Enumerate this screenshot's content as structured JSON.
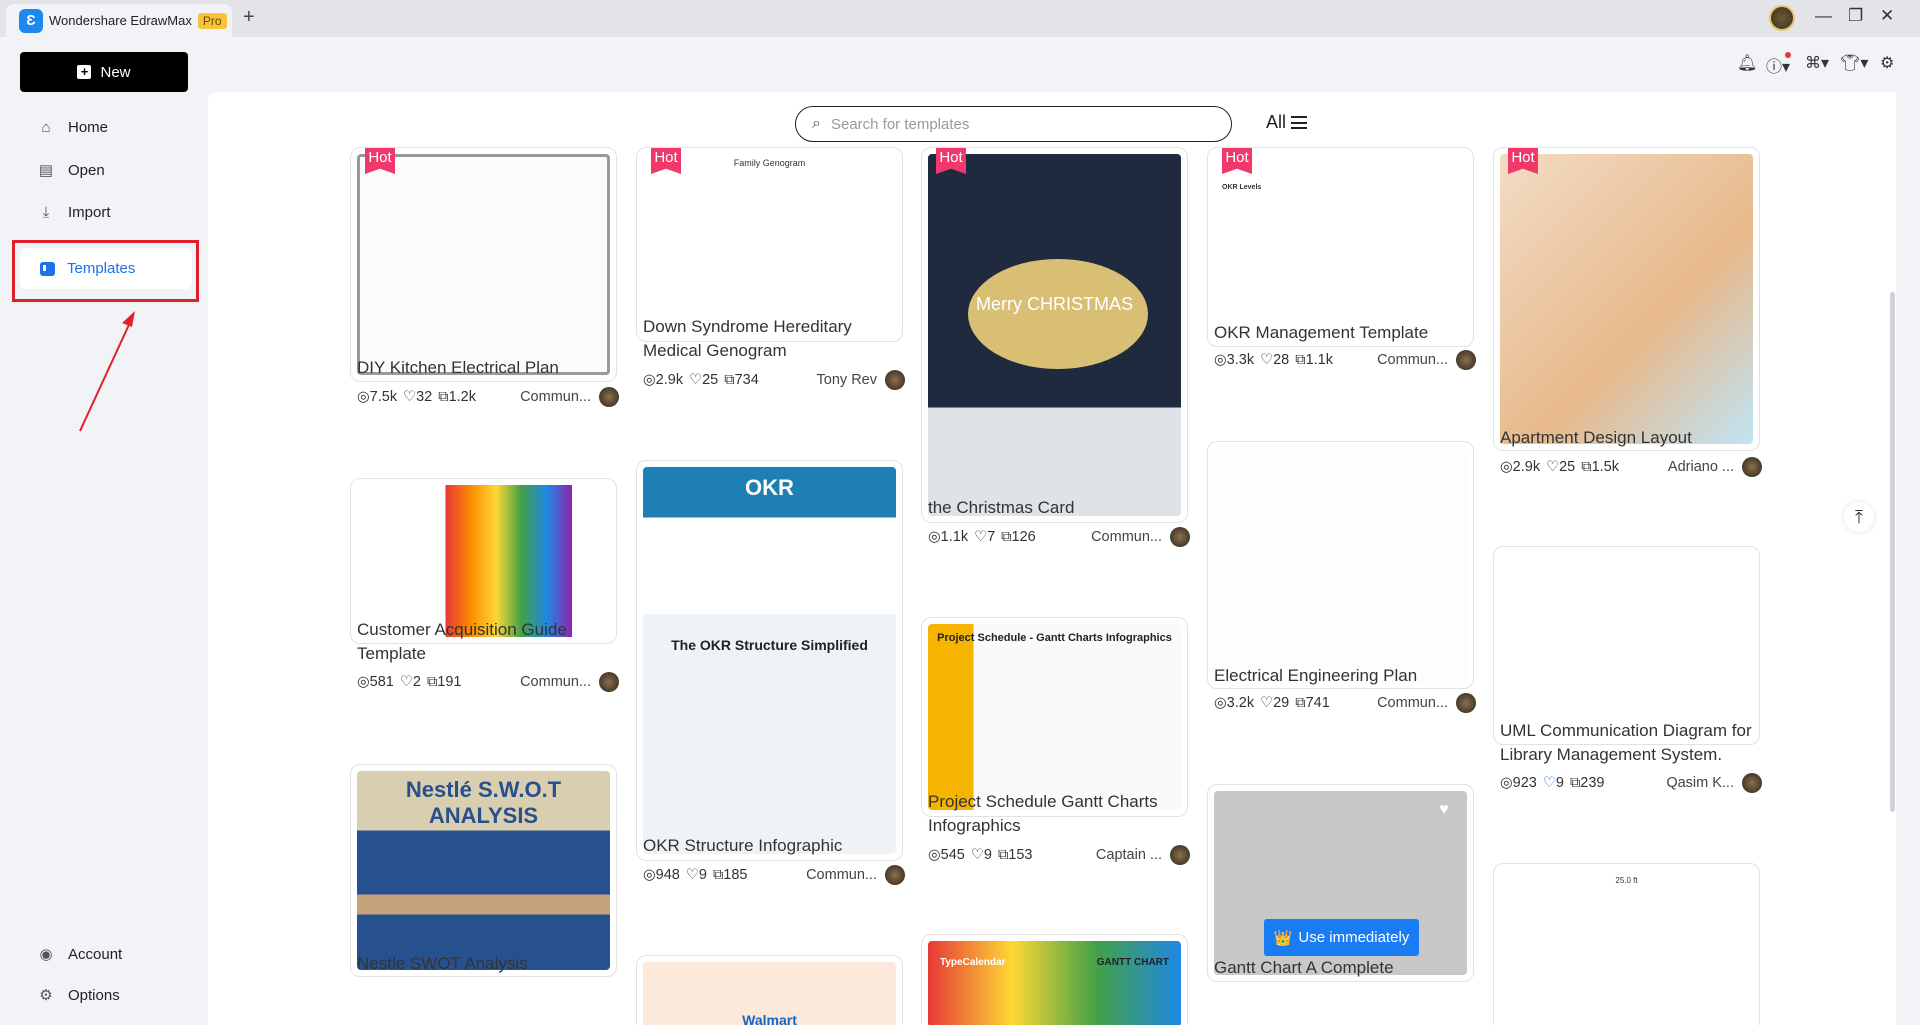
{
  "app": {
    "name": "Wondershare EdrawMax",
    "badge": "Pro",
    "new_tab": "+"
  },
  "window": {
    "minimize": "—",
    "restore": "❐",
    "close": "✕"
  },
  "toolbar": {
    "icons": [
      "bell-icon",
      "help-icon",
      "apps-icon",
      "theme-icon",
      "settings-icon"
    ]
  },
  "sidebar": {
    "new_label": "New",
    "items": [
      {
        "label": "Home"
      },
      {
        "label": "Open"
      },
      {
        "label": "Import"
      },
      {
        "label": "Templates",
        "active": true
      }
    ],
    "account": "Account",
    "options": "Options"
  },
  "search": {
    "placeholder": "Search for templates",
    "value": "",
    "filter": "All"
  },
  "accent": "#1a73e8",
  "highlight_color": "#e0202a",
  "use_button": "Use immediately",
  "cards": [
    {
      "title": "DIY Kitchen Electrical Plan",
      "views": "7.5k",
      "likes": "32",
      "dupes": "1.2k",
      "author": "Commun...",
      "hot": true,
      "thumb": "kitchen"
    },
    {
      "title": "Customer Acquisition Guide Template",
      "views": "581",
      "likes": "2",
      "dupes": "191",
      "author": "Commun...",
      "hot": false,
      "thumb": "funnel"
    },
    {
      "title": "Nestle SWOT Analysis",
      "hot": false,
      "thumb": "nestle",
      "text": "Nestlé S.W.O.T ANALYSIS"
    },
    {
      "title": "Down Syndrome Hereditary Medical Genogram",
      "views": "2.9k",
      "likes": "25",
      "dupes": "734",
      "author": "Tony Rev",
      "hot": true,
      "thumb": "genogram",
      "text": "Family Genogram"
    },
    {
      "title": "OKR Structure Infographic",
      "views": "948",
      "likes": "9",
      "dupes": "185",
      "author": "Commun...",
      "hot": false,
      "thumb": "okr",
      "text": "OKR",
      "text2": "The OKR Structure Simplified"
    },
    {
      "hot": false,
      "thumb": "walmart",
      "text": "Walmart"
    },
    {
      "title": "the Christmas Card",
      "views": "1.1k",
      "likes": "7",
      "dupes": "126",
      "author": "Commun...",
      "hot": true,
      "thumb": "xmas",
      "text": "Merry CHRISTMAS"
    },
    {
      "title": "Project Schedule Gantt Charts Infographics",
      "views": "545",
      "likes": "9",
      "dupes": "153",
      "author": "Captain ...",
      "hot": false,
      "thumb": "schedule",
      "text": "Project Schedule - Gantt Charts Infographics"
    },
    {
      "hot": false,
      "thumb": "typecal",
      "text": "TypeCalendar",
      "text2": "GANTT CHART"
    },
    {
      "title": "OKR Management Template",
      "views": "3.3k",
      "likes": "28",
      "dupes": "1.1k",
      "author": "Commun...",
      "hot": true,
      "thumb": "okrmgmt",
      "text": "OKR Levels"
    },
    {
      "title": "Electrical Engineering Plan",
      "views": "3.2k",
      "likes": "29",
      "dupes": "741",
      "author": "Commun...",
      "hot": false,
      "thumb": "elec"
    },
    {
      "title": "Gantt Chart A Complete",
      "hot": false,
      "thumb": "gantt",
      "hover": true
    },
    {
      "title": "Apartment Design Layout",
      "views": "2.9k",
      "likes": "25",
      "dupes": "1.5k",
      "author": "Adriano ...",
      "hot": true,
      "thumb": "apartment"
    },
    {
      "title": "UML Communication Diagram for Library Management System.",
      "views": "923",
      "likes": "9",
      "dupes": "239",
      "author": "Qasim K...",
      "hot": false,
      "liked": true,
      "thumb": "uml"
    },
    {
      "hot": false,
      "thumb": "floor",
      "text": "25.0 ft"
    }
  ]
}
